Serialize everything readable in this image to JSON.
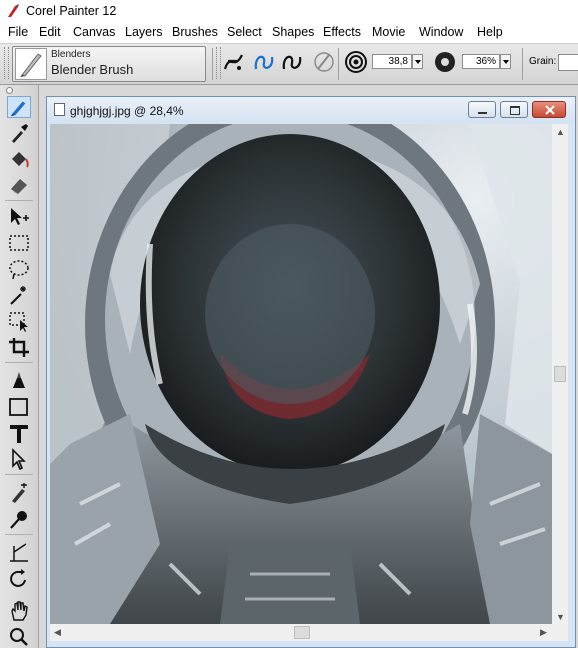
{
  "window": {
    "title": "Corel Painter 12"
  },
  "menu": [
    "File",
    "Edit",
    "Canvas",
    "Layers",
    "Brushes",
    "Select",
    "Shapes",
    "Effects",
    "Movie",
    "Window",
    "Help"
  ],
  "property_bar": {
    "brush_category": "Blenders",
    "brush_variant": "Blender Brush",
    "size_value": "38,8",
    "opacity_value": "36%",
    "grain_label": "Grain:"
  },
  "document": {
    "title": "ghjghjgj.jpg @ 28,4%"
  },
  "colors": {
    "accent": "#1a6fd0",
    "close_button": "#c74a33",
    "doc_frame": "#d6e4f3"
  }
}
